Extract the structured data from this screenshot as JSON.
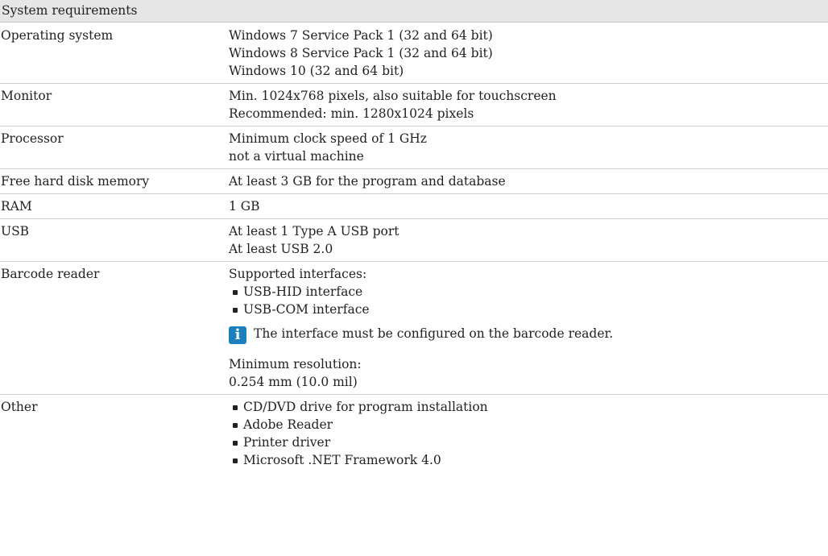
{
  "header": "System requirements",
  "rows": {
    "os": {
      "label": "Operating system",
      "lines": [
        "Windows 7 Service Pack 1 (32 and 64 bit)",
        "Windows 8 Service Pack 1 (32 and 64 bit)",
        "Windows 10 (32 and 64 bit)"
      ]
    },
    "monitor": {
      "label": "Monitor",
      "lines": [
        "Min. 1024x768 pixels, also suitable for touchscreen",
        "Recommended: min. 1280x1024 pixels"
      ]
    },
    "processor": {
      "label": "Processor",
      "lines": [
        "Minimum clock speed of 1 GHz",
        "not a virtual machine"
      ]
    },
    "disk": {
      "label": "Free hard disk memory",
      "lines": [
        "At least 3 GB for the program and database"
      ]
    },
    "ram": {
      "label": "RAM",
      "lines": [
        "1 GB"
      ]
    },
    "usb": {
      "label": "USB",
      "lines": [
        "At least 1 Type A USB port",
        "At least USB 2.0"
      ]
    },
    "barcode": {
      "label": "Barcode reader",
      "intro": "Supported interfaces:",
      "bullets": [
        "USB-HID interface",
        "USB-COM interface"
      ],
      "note": {
        "icon": "info-icon",
        "text": "The interface must be configured on the barcode reader."
      },
      "resolution_label": "Minimum resolution:",
      "resolution_value": "0.254 mm (10.0 mil)"
    },
    "other": {
      "label": "Other",
      "bullets": [
        "CD/DVD drive for program installation",
        "Adobe Reader",
        "Printer driver",
        "Microsoft .NET Framework 4.0"
      ]
    }
  },
  "colors": {
    "header_bg": "#e6e6e6",
    "info_icon": "#1c7fbe"
  }
}
